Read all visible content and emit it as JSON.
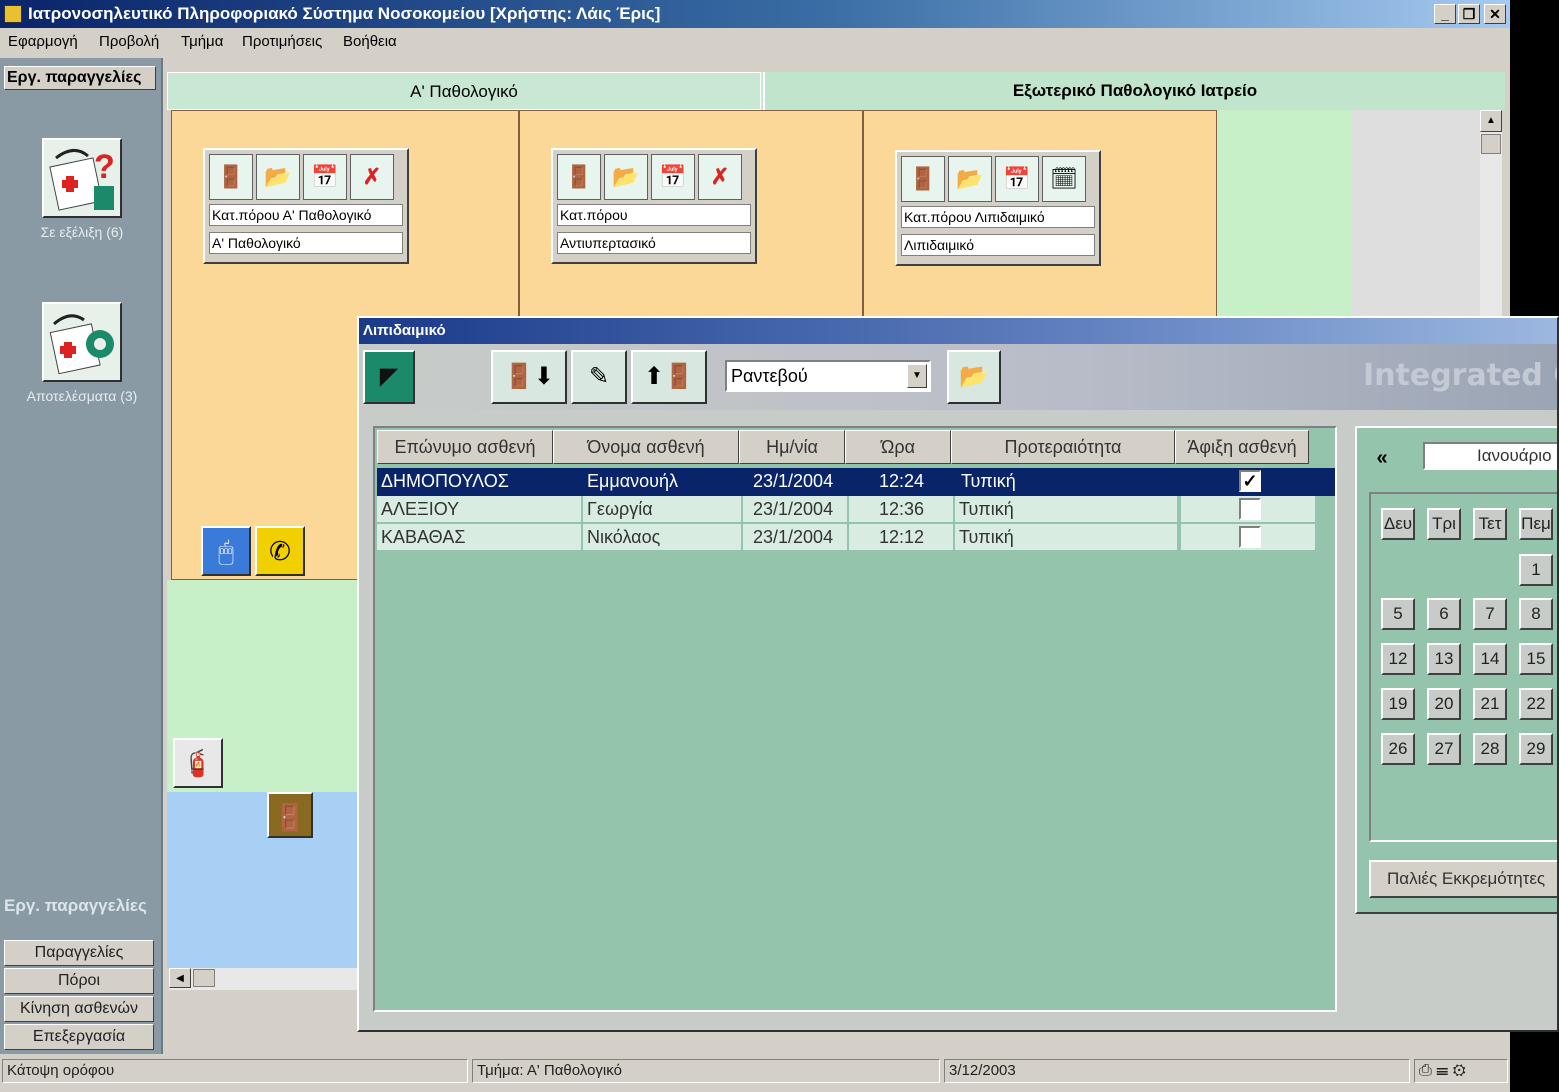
{
  "window": {
    "title": "Ιατρονοσηλευτικό Πληροφοριακό Σύστημα Νοσοκομείου [Χρήστης: Λάις Έρις]",
    "minimize_label": "_",
    "restore_label": "❐",
    "close_label": "✕"
  },
  "menu": [
    "Εφαρμογή",
    "Προβολή",
    "Τμήμα",
    "Προτιμήσεις",
    "Βοήθεια"
  ],
  "left_panel": {
    "header": "Εργ. παραγγελίες",
    "in_progress_label": "Σε εξέλιξη (6)",
    "results_label": "Αποτελέσματα (3)",
    "footer_header": "Εργ. παραγγελίες",
    "buttons": [
      "Παραγγελίες",
      "Πόροι",
      "Κίνηση ασθενών",
      "Επεξεργασία"
    ]
  },
  "tabs": {
    "tab1": "Α' Παθολογικό",
    "tab2": "Εξωτερικό Παθολογικό Ιατρείο"
  },
  "rooms": [
    {
      "line1": "Κατ.πόρου Α' Παθολογικό",
      "line2": "Α' Παθολογικό"
    },
    {
      "line1": "Κατ.πόρου",
      "line2": "Αντιυπερτασικό"
    },
    {
      "line1": "Κατ.πόρου Λιπιδαιμικό",
      "line2": "Λιπιδαιμικό"
    }
  ],
  "dialog": {
    "title": "Λιπιδαιμικό",
    "dropdown_value": "Ραντεβού",
    "brand": "Integrated Ca",
    "columns": [
      "Επώνυμο ασθενή",
      "Όνομα ασθενή",
      "Ημ/νία",
      "Ώρα",
      "Προτεραιότητα",
      "Άφιξη ασθενή"
    ],
    "rows": [
      {
        "surname": "ΔΗΜΟΠΟΥΛΟΣ",
        "name": "Εμμανουήλ",
        "date": "23/1/2004",
        "time": "12:24",
        "priority": "Τυπική",
        "arrived": true
      },
      {
        "surname": "ΑΛΕΞΙΟΥ",
        "name": "Γεωργία",
        "date": "23/1/2004",
        "time": "12:36",
        "priority": "Τυπική",
        "arrived": false
      },
      {
        "surname": "ΚΑΒΑΘΑΣ",
        "name": "Νικόλαος",
        "date": "23/1/2004",
        "time": "12:12",
        "priority": "Τυπική",
        "arrived": false
      }
    ],
    "calendar": {
      "prev_label": "«",
      "month": "Ιανουάριο",
      "day_headers": [
        "Δευ",
        "Τρι",
        "Τετ",
        "Πεμ"
      ],
      "days": [
        "1",
        "5",
        "6",
        "7",
        "8",
        "12",
        "13",
        "14",
        "15",
        "19",
        "20",
        "21",
        "22",
        "26",
        "27",
        "28",
        "29"
      ],
      "old_pending_label": "Παλιές Εκκρεμότητες"
    }
  },
  "status": {
    "floor": "Κάτοψη ορόφου",
    "department": "Τμήμα: Α' Παθολογικό",
    "date": "3/12/2003"
  },
  "colors": {
    "selected_row": "#0a246a",
    "room_fill": "#fcd898",
    "grid_bg": "#94c4ac"
  }
}
